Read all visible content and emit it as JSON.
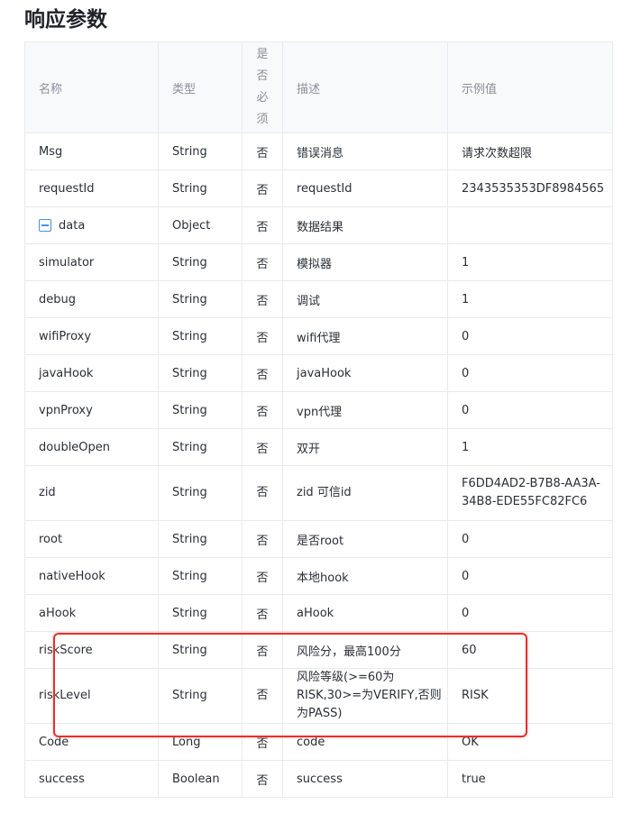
{
  "title": "响应参数",
  "headers": {
    "name": "名称",
    "type": "类型",
    "required": "是否必须",
    "description": "描述",
    "example": "示例值"
  },
  "rows": [
    {
      "name": "Msg",
      "type": "String",
      "required": "否",
      "desc": "错误消息",
      "example": "请求次数超限"
    },
    {
      "name": "requestId",
      "type": "String",
      "required": "否",
      "desc": "requestId",
      "example": "2343535353DF8984565"
    },
    {
      "name": "data",
      "type": "Object",
      "required": "否",
      "desc": "数据结果",
      "example": ""
    },
    {
      "name": "simulator",
      "type": "String",
      "required": "否",
      "desc": "模拟器",
      "example": "1"
    },
    {
      "name": "debug",
      "type": "String",
      "required": "否",
      "desc": "调试",
      "example": "1"
    },
    {
      "name": "wifiProxy",
      "type": "String",
      "required": "否",
      "desc": "wifi代理",
      "example": "0"
    },
    {
      "name": "javaHook",
      "type": "String",
      "required": "否",
      "desc": "javaHook",
      "example": "0"
    },
    {
      "name": "vpnProxy",
      "type": "String",
      "required": "否",
      "desc": "vpn代理",
      "example": "0"
    },
    {
      "name": "doubleOpen",
      "type": "String",
      "required": "否",
      "desc": "双开",
      "example": "1"
    },
    {
      "name": "zid",
      "type": "String",
      "required": "否",
      "desc": "zid 可信id",
      "example": "F6DD4AD2-B7B8-AA3A-34B8-EDE55FC82FC6"
    },
    {
      "name": "root",
      "type": "String",
      "required": "否",
      "desc": "是否root",
      "example": "0"
    },
    {
      "name": "nativeHook",
      "type": "String",
      "required": "否",
      "desc": "本地hook",
      "example": "0"
    },
    {
      "name": "aHook",
      "type": "String",
      "required": "否",
      "desc": "aHook",
      "example": "0"
    },
    {
      "name": "riskScore",
      "type": "String",
      "required": "否",
      "desc": "风险分，最高100分",
      "example": "60"
    },
    {
      "name": "riskLevel",
      "type": "String",
      "required": "否",
      "desc": "风险等级(>=60为RISK,30>=为VERIFY,否则为PASS)",
      "example": "RISK"
    },
    {
      "name": "Code",
      "type": "Long",
      "required": "否",
      "desc": "code",
      "example": "OK"
    },
    {
      "name": "success",
      "type": "Boolean",
      "required": "否",
      "desc": "success",
      "example": "true"
    }
  ],
  "colors": {
    "highlight": "#e8302a",
    "toggle": "#4a90e2",
    "header_bg": "#f8f9fa",
    "border": "#e8eaed"
  },
  "icons": {
    "data_toggle": "collapse-minus-icon"
  }
}
